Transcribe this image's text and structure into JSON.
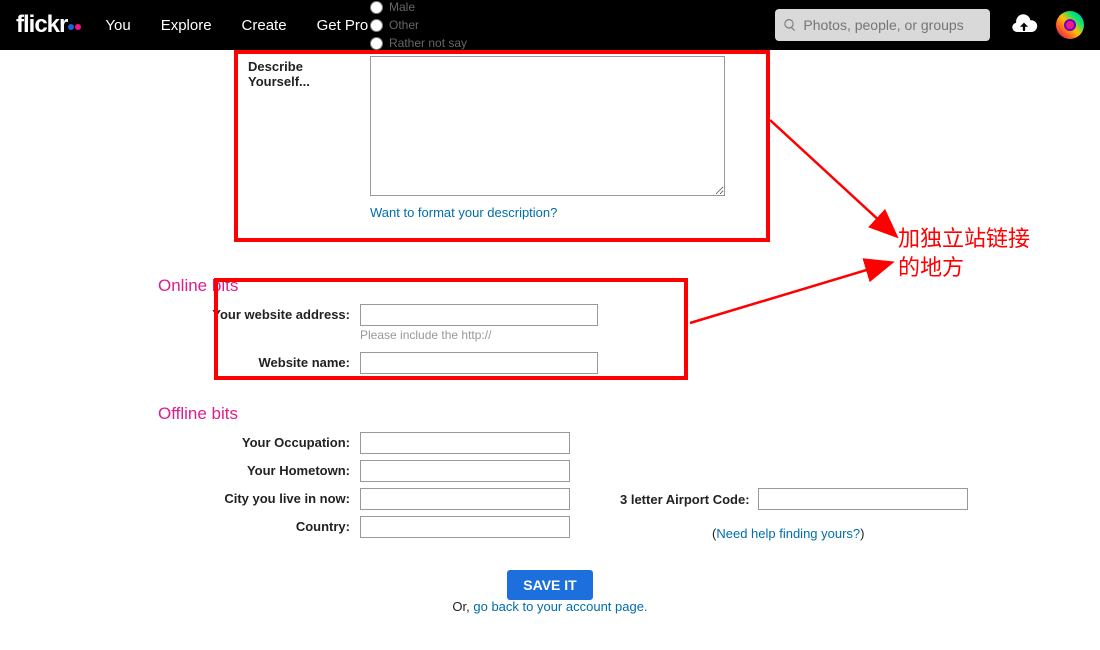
{
  "nav": {
    "logo_text": "flickr",
    "items": [
      "You",
      "Explore",
      "Create",
      "Get Pro"
    ],
    "search_placeholder": "Photos, people, or groups"
  },
  "radio_peek": {
    "opt1": "Male",
    "opt2": "Other",
    "opt3": "Rather not say"
  },
  "describe": {
    "label": "Describe Yourself...",
    "textarea_value": "",
    "format_link": "Want to format your description?"
  },
  "online_bits": {
    "heading": "Online bits",
    "website_address_label": "Your website address:",
    "website_address_value": "",
    "website_address_hint": "Please include the http://",
    "website_name_label": "Website name:",
    "website_name_value": ""
  },
  "offline_bits": {
    "heading": "Offline bits",
    "occupation_label": "Your Occupation:",
    "occupation_value": "",
    "hometown_label": "Your Hometown:",
    "hometown_value": "",
    "city_label": "City you live in now:",
    "city_value": "",
    "airport_label": "3 letter Airport Code:",
    "airport_value": "",
    "airport_help_text": "Need help finding yours?",
    "country_label": "Country:",
    "country_value": ""
  },
  "actions": {
    "save_label": "SAVE IT",
    "or_prefix": "Or, ",
    "back_link": "go back to your account page."
  },
  "annotation": {
    "line1": "加独立站链接",
    "line2": "的地方"
  }
}
